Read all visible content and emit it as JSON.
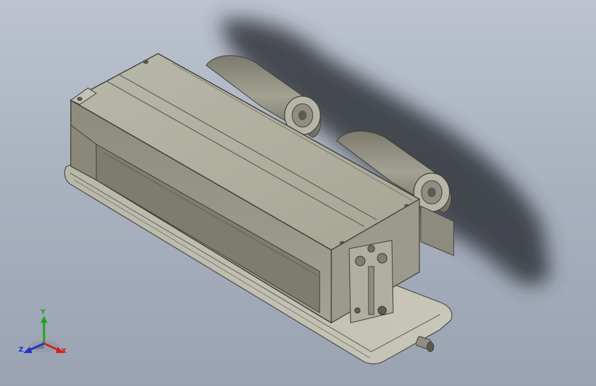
{
  "viewport": {
    "background_top": "#bcc3cf",
    "background_bottom": "#9aa3b2",
    "model_color": "#a9a898",
    "shadow_color": "#3a3d42"
  },
  "triad": {
    "x_label": "X",
    "y_label": "Y",
    "z_label": "Z",
    "x_color": "#d42020",
    "y_color": "#1aa51a",
    "z_color": "#2232c8"
  }
}
